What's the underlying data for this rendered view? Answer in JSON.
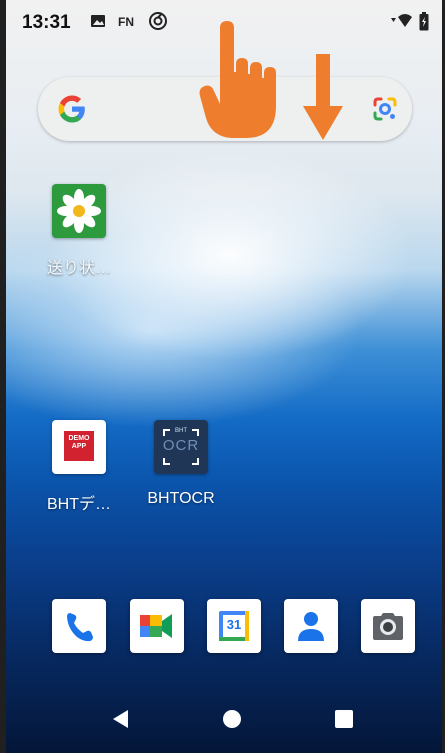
{
  "status_bar": {
    "time": "13:31",
    "fn_label": "FN",
    "icons": [
      "image-icon",
      "fn-indicator",
      "sync-icon",
      "wifi-icon",
      "battery-icon"
    ]
  },
  "search_widget": {
    "logo": "google-g-icon",
    "lens": "google-lens-icon"
  },
  "home_apps": [
    {
      "label": "送り状…",
      "icon": "flower-app-icon"
    },
    {
      "label": "BHTデ…",
      "icon": "demo-app-icon",
      "icon_text_1": "DEMO",
      "icon_text_2": "APP"
    },
    {
      "label": "BHTOCR",
      "icon": "ocr-app-icon",
      "icon_text_1": "BHT",
      "icon_text_2": "OCR"
    }
  ],
  "dock": [
    {
      "name": "phone",
      "icon": "phone-icon"
    },
    {
      "name": "meet",
      "icon": "video-call-icon"
    },
    {
      "name": "calendar",
      "icon": "calendar-icon",
      "day": "31"
    },
    {
      "name": "contacts",
      "icon": "contacts-icon"
    },
    {
      "name": "camera",
      "icon": "camera-icon"
    }
  ],
  "nav_bar": [
    "back-icon",
    "home-icon",
    "recents-icon"
  ],
  "gesture_hint": {
    "icons": [
      "swipe-hand-icon",
      "down-arrow-icon"
    ],
    "color": "#ee7d2e"
  },
  "colors": {
    "accent_orange": "#ee7d2e",
    "flower_green": "#2e9a3e",
    "demo_red": "#d3222f",
    "ocr_navy": "#1f3656"
  }
}
